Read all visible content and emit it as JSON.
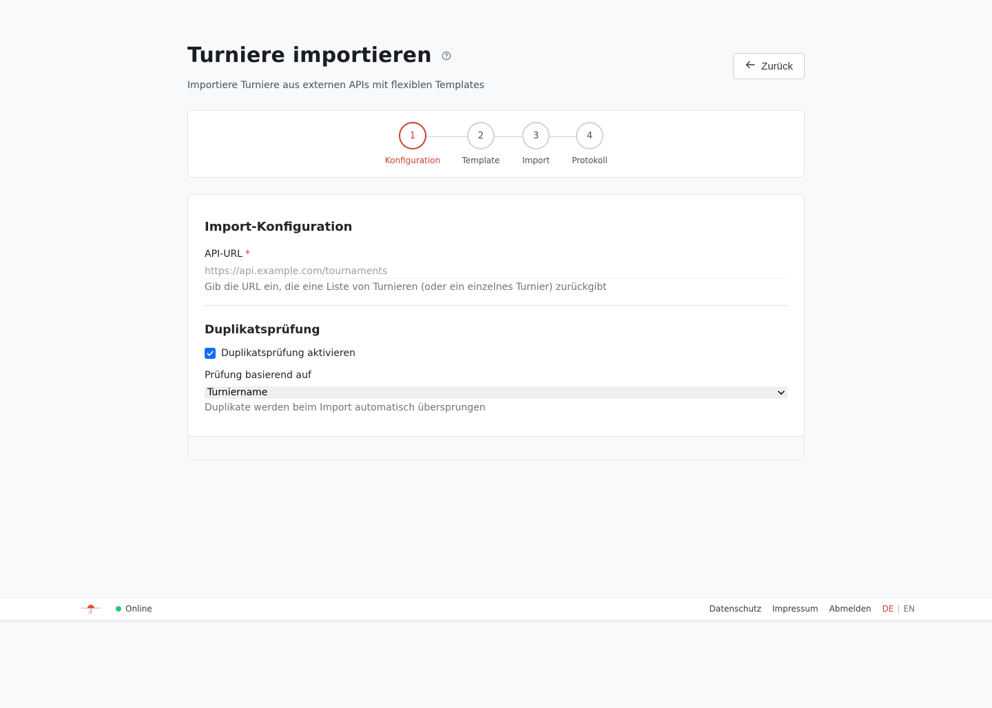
{
  "header": {
    "title": "Turniere importieren",
    "subtitle": "Importiere Turniere aus externen APIs mit flexiblen Templates",
    "back_label": "Zurück"
  },
  "stepper": {
    "steps": [
      {
        "number": "1",
        "label": "Konfiguration",
        "active": true
      },
      {
        "number": "2",
        "label": "Template",
        "active": false
      },
      {
        "number": "3",
        "label": "Import",
        "active": false
      },
      {
        "number": "4",
        "label": "Protokoll",
        "active": false
      }
    ]
  },
  "config": {
    "section_title": "Import-Konfiguration",
    "api_url_label": "API-URL",
    "required_marker": "*",
    "api_url_placeholder": "https://api.example.com/tournaments",
    "api_url_value": "",
    "api_url_help": "Gib die URL ein, die eine Liste von Turnieren (oder ein einzelnes Turnier) zurückgibt"
  },
  "duplicates": {
    "section_title": "Duplikatsprüfung",
    "checkbox_label": "Duplikatsprüfung aktivieren",
    "checked": true,
    "basis_label": "Prüfung basierend auf",
    "basis_selected": "Turniername",
    "help": "Duplikate werden beim Import automatisch übersprungen"
  },
  "footer": {
    "status": "Online",
    "links": [
      "Datenschutz",
      "Impressum",
      "Abmelden"
    ],
    "lang_de": "DE",
    "lang_separator": "|",
    "lang_en": "EN"
  },
  "colors": {
    "accent": "#c9412d",
    "checkbox": "#0d6efd",
    "online": "#28c76f"
  }
}
